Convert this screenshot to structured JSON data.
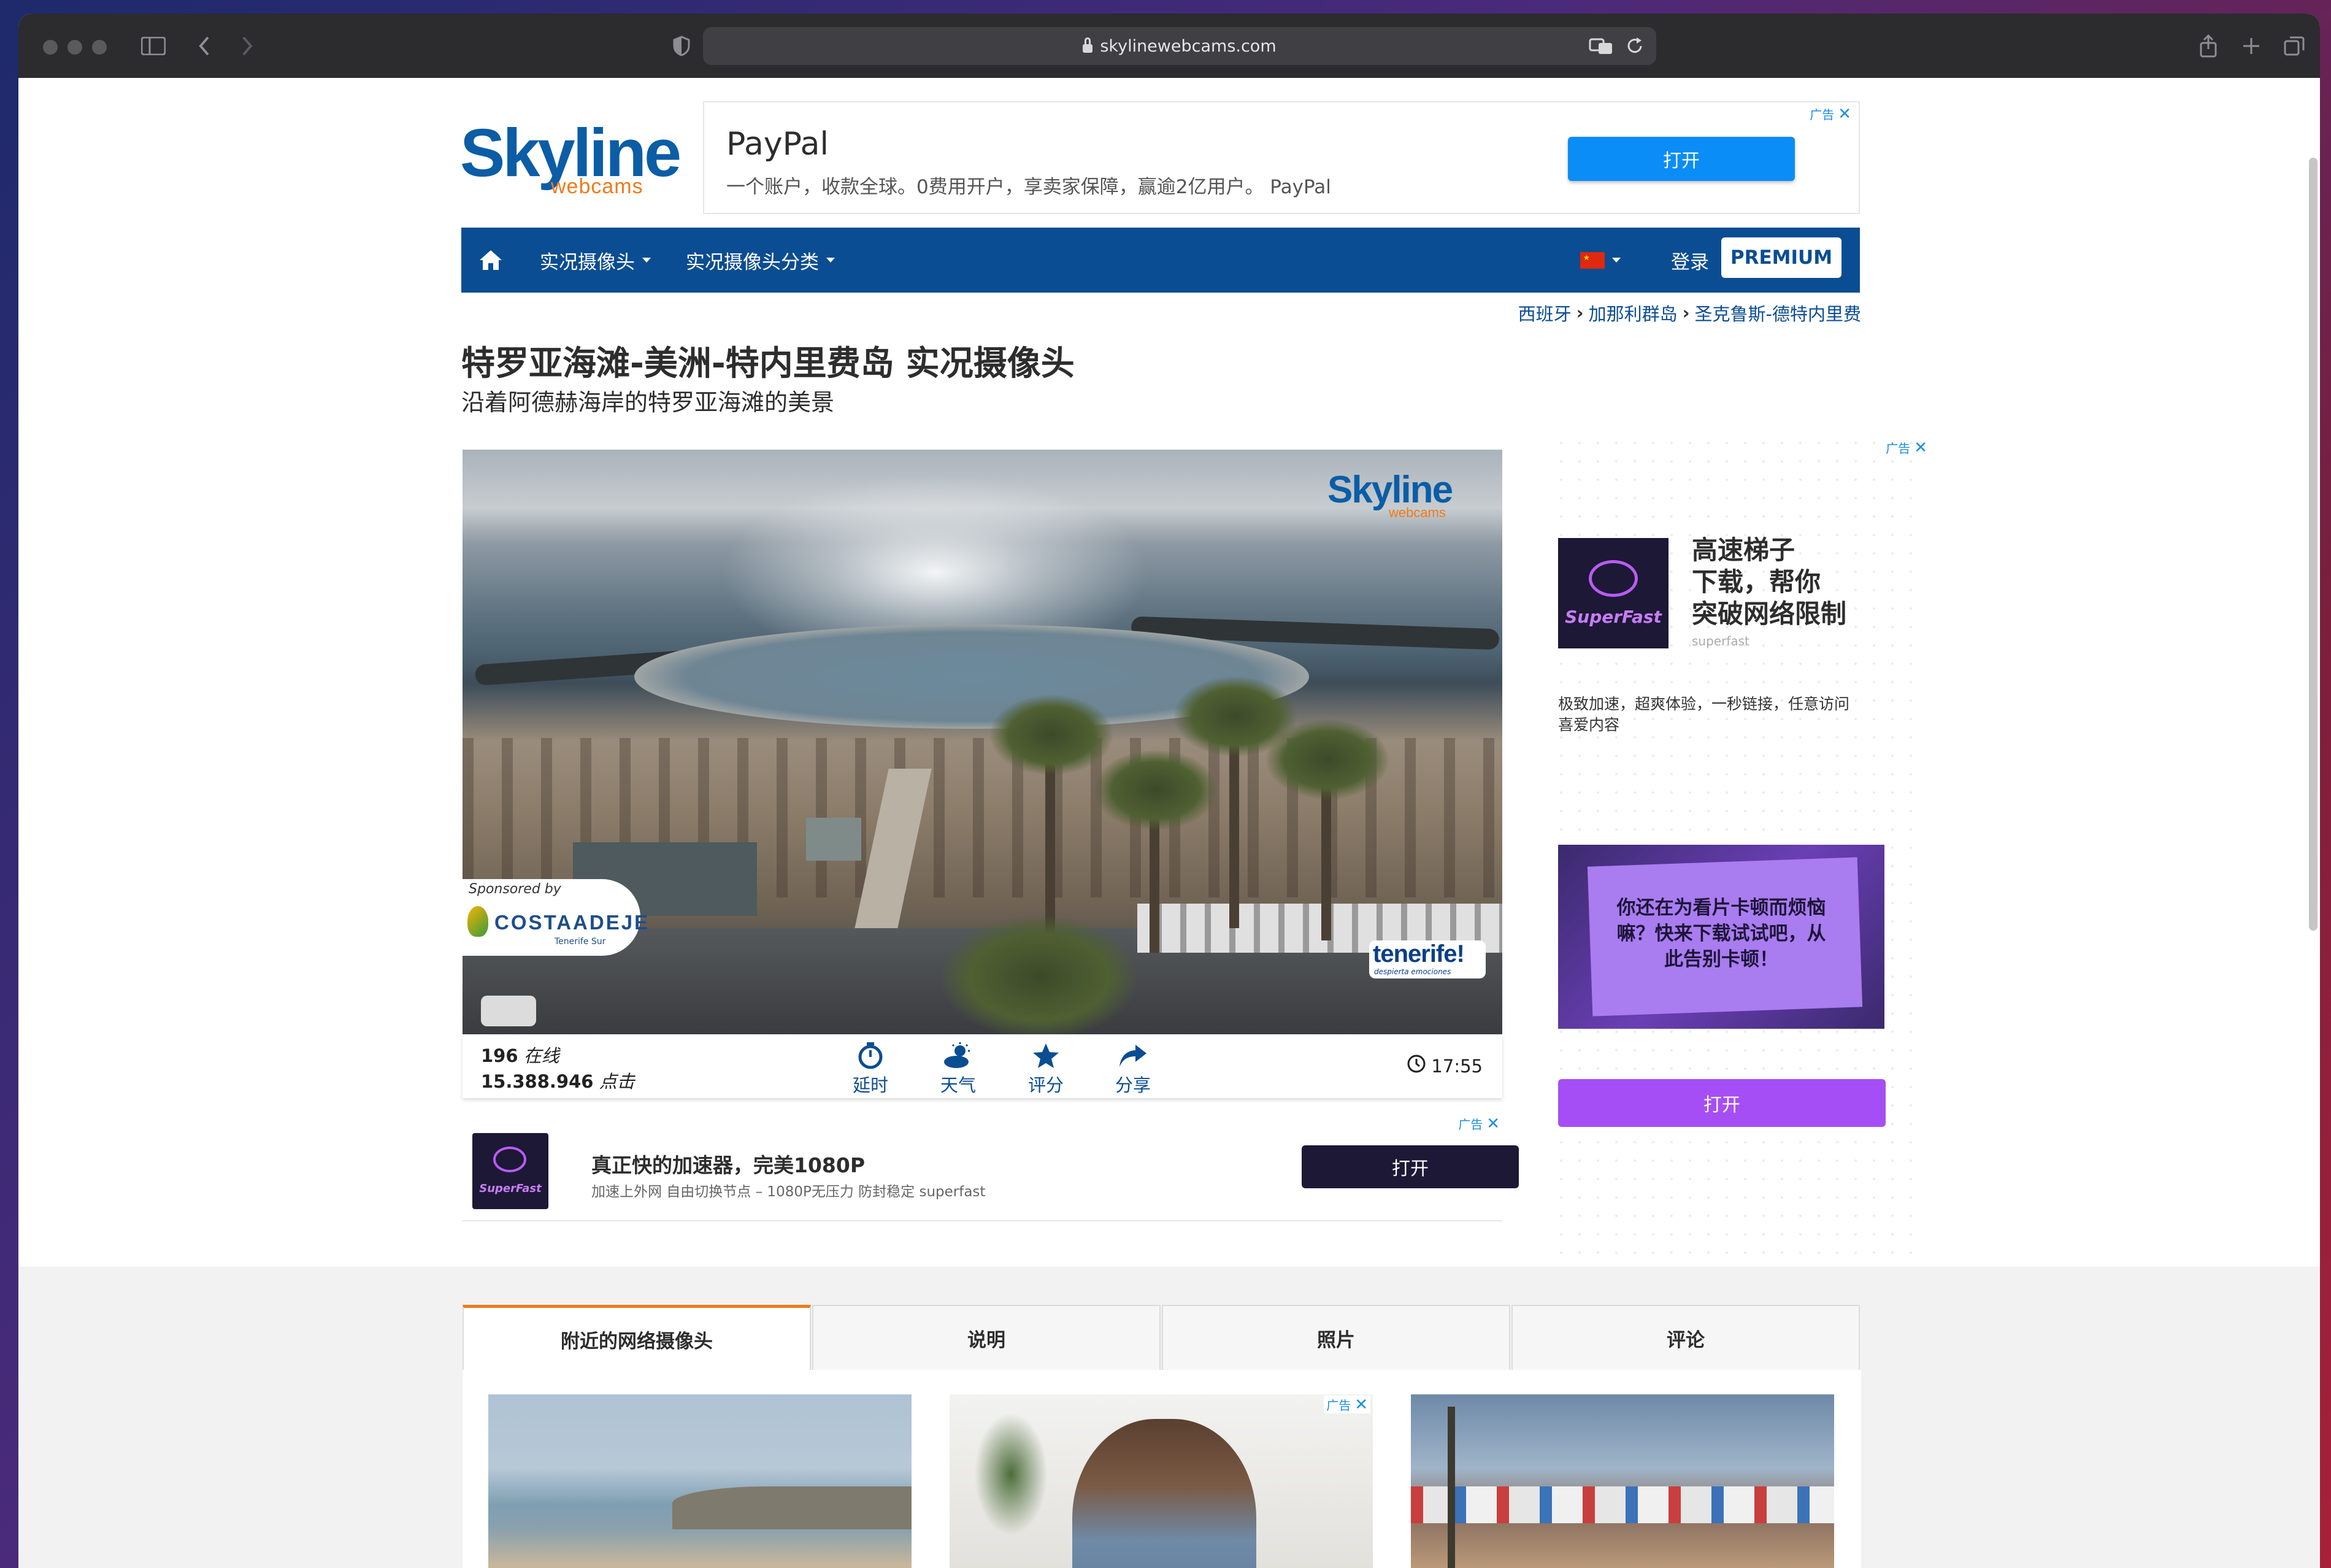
{
  "browser": {
    "url": "skylinewebcams.com"
  },
  "site": {
    "logo_main": "Skyline",
    "logo_sub": "webcams"
  },
  "top_ad": {
    "tag": "广告",
    "title": "PayPal",
    "desc": "一个账户，收款全球。0费用开户，享卖家保障，赢逾2亿用户。 PayPal",
    "button": "打开",
    "color": "#0a8df7"
  },
  "nav": {
    "live_cams": "实况摄像头",
    "categories": "实况摄像头分类",
    "login": "登录",
    "premium": "PREMIUM",
    "bg": "#0b4d92"
  },
  "breadcrumb": [
    "西班牙",
    "加那利群岛",
    "圣克鲁斯-德特内里费"
  ],
  "title": "特罗亚海滩-美洲-特内里费岛 实况摄像头",
  "subtitle": "沿着阿德赫海岸的特罗亚海滩的美景",
  "video": {
    "watermark_main": "Skyline",
    "watermark_sub": "webcams",
    "sponsored_by": "Sponsored by",
    "sponsor_name": "COSTAADEJE",
    "sponsor_tag": "Tenerife Sur",
    "tenerife_logo": "tenerife!",
    "tenerife_tag": "despierta emociones"
  },
  "stats": {
    "online_count": "196",
    "online_label": "在线",
    "hits_count": "15.388.946",
    "hits_label": "点击",
    "time": "17:55",
    "tools": [
      {
        "label": "延时",
        "icon": "timelapse-icon"
      },
      {
        "label": "天气",
        "icon": "weather-icon"
      },
      {
        "label": "评分",
        "icon": "star-icon"
      },
      {
        "label": "分享",
        "icon": "share-icon"
      }
    ]
  },
  "bottom_ad": {
    "tag": "广告",
    "logo": "SuperFast",
    "title": "真正快的加速器，完美1080P",
    "desc": "加速上外网 自由切换节点 – 1080P无压力 防封稳定 superfast",
    "button": "打开"
  },
  "side_ad": {
    "tag": "广告",
    "logo": "SuperFast",
    "title": "高速梯子下载，帮你突破网络限制",
    "title_lines": [
      "高速梯子",
      "下载，帮你",
      "突破网络限制"
    ],
    "source": "superfast",
    "desc_lines": [
      "极致加速，超爽体验，一秒链接，任意访问",
      "喜爱内容"
    ],
    "image_text_lines": [
      "你还在为看片卡顿而烦恼",
      "嘛？快来下载试试吧，从",
      "此告别卡顿！"
    ],
    "button": "打开",
    "accent": "#a64ef5"
  },
  "tabs": [
    {
      "label": "附近的网络摄像头",
      "active": true
    },
    {
      "label": "说明",
      "active": false
    },
    {
      "label": "照片",
      "active": false
    },
    {
      "label": "评论",
      "active": false
    }
  ],
  "thumb_ad": {
    "tag": "广告"
  }
}
